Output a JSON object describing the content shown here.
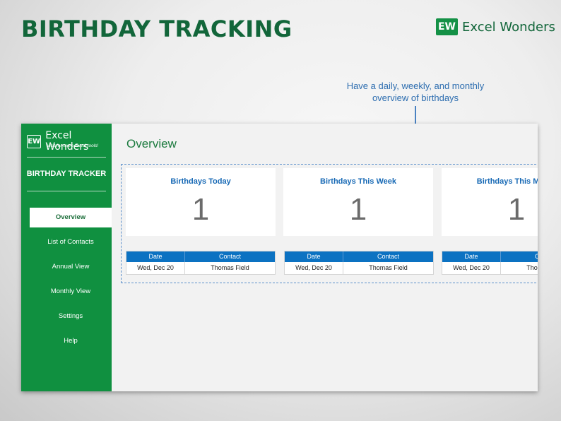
{
  "page": {
    "title": "BIRTHDAY TRACKING",
    "brand": {
      "logo": "EW",
      "name": "Excel Wonders"
    }
  },
  "callout": {
    "text": "Have a daily, weekly, and monthly overview of birthdays"
  },
  "sidebar": {
    "logo": "EW",
    "brand_name": "Excel Wonders",
    "tagline": "Visit for more Excel tools!",
    "title": "BIRTHDAY TRACKER",
    "items": [
      {
        "label": "Overview",
        "active": true
      },
      {
        "label": "List of Contacts",
        "active": false
      },
      {
        "label": "Annual View",
        "active": false
      },
      {
        "label": "Monthly View",
        "active": false
      },
      {
        "label": "Settings",
        "active": false
      },
      {
        "label": "Help",
        "active": false
      }
    ]
  },
  "main": {
    "title": "Overview",
    "cards": [
      {
        "title": "Birthdays Today",
        "count": "1"
      },
      {
        "title": "Birthdays This Week",
        "count": "1"
      },
      {
        "title": "Birthdays This Month",
        "count": "1"
      }
    ],
    "tables": [
      {
        "headers": [
          "Date",
          "Contact"
        ],
        "rows": [
          [
            "Wed, Dec 20",
            "Thomas Field"
          ]
        ]
      },
      {
        "headers": [
          "Date",
          "Contact"
        ],
        "rows": [
          [
            "Wed, Dec 20",
            "Thomas Field"
          ]
        ]
      },
      {
        "headers": [
          "Date",
          "Contact"
        ],
        "rows": [
          [
            "Wed, Dec 20",
            "Thomas Field"
          ]
        ]
      }
    ]
  },
  "colors": {
    "brand_green": "#109040",
    "title_green": "#12663a",
    "accent_blue": "#1769b5",
    "table_header_blue": "#0c72c2",
    "callout_blue": "#2e6eb0"
  }
}
